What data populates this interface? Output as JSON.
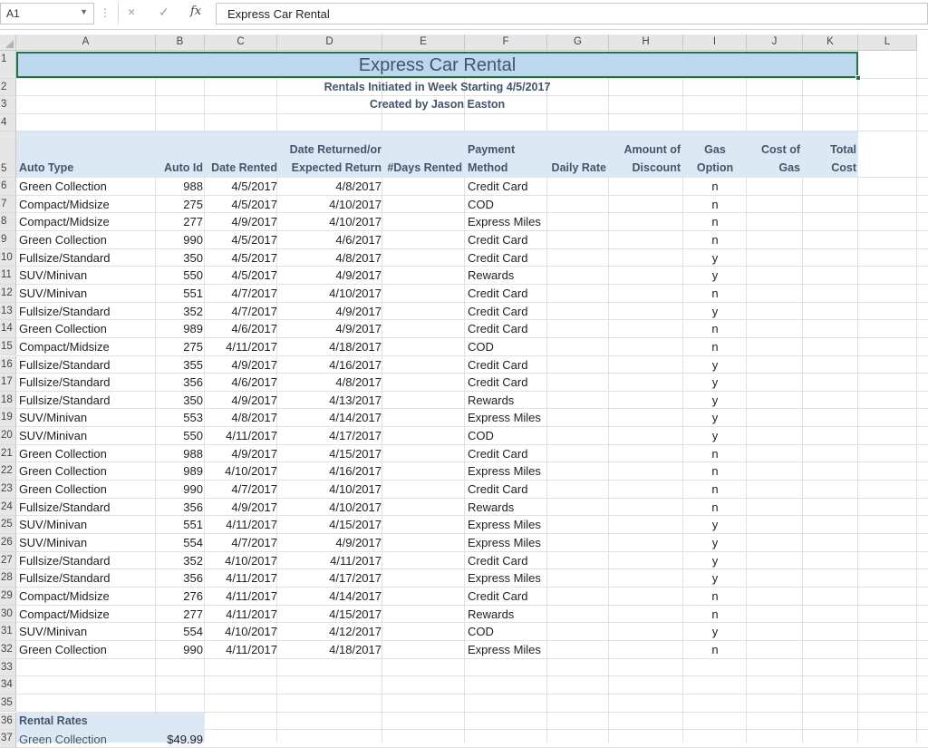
{
  "formula_bar": {
    "name_box": "A1",
    "formula": "Express Car Rental",
    "fx": "fx",
    "cancel": "×",
    "enter": "✓",
    "dots": "⋮",
    "dropdown": "▼"
  },
  "columns": [
    "A",
    "B",
    "C",
    "D",
    "E",
    "F",
    "G",
    "H",
    "I",
    "J",
    "K",
    "L"
  ],
  "title": "Express Car Rental",
  "subtitle1": "Rentals Initiated in Week Starting 4/5/2017",
  "subtitle2": "Created by Jason Easton",
  "headers": {
    "auto_type": "Auto Type",
    "auto_id": "Auto Id",
    "date_rented": "Date Rented",
    "returned_l1": "Date Returned/or",
    "returned_l2": "Expected Return",
    "days": "#Days Rented",
    "payment_l1": "Payment",
    "payment_l2": "Method",
    "daily_rate": "Daily Rate",
    "discount_l1": "Amount of",
    "discount_l2": "Discount",
    "gas_l1": "Gas",
    "gas_l2": "Option",
    "costgas_l1": "Cost of",
    "costgas_l2": "Gas",
    "total_l1": "Total",
    "total_l2": "Cost"
  },
  "rows": [
    {
      "type": "Green Collection",
      "id": "988",
      "rented": "4/5/2017",
      "returned": "4/8/2017",
      "payment": "Credit Card",
      "gas": "n"
    },
    {
      "type": "Compact/Midsize",
      "id": "275",
      "rented": "4/5/2017",
      "returned": "4/10/2017",
      "payment": "COD",
      "gas": "n"
    },
    {
      "type": "Compact/Midsize",
      "id": "277",
      "rented": "4/9/2017",
      "returned": "4/10/2017",
      "payment": "Express Miles",
      "gas": "n"
    },
    {
      "type": "Green Collection",
      "id": "990",
      "rented": "4/5/2017",
      "returned": "4/6/2017",
      "payment": "Credit Card",
      "gas": "n"
    },
    {
      "type": "Fullsize/Standard",
      "id": "350",
      "rented": "4/5/2017",
      "returned": "4/8/2017",
      "payment": "Credit Card",
      "gas": "y"
    },
    {
      "type": "SUV/Minivan",
      "id": "550",
      "rented": "4/5/2017",
      "returned": "4/9/2017",
      "payment": "Rewards",
      "gas": "y"
    },
    {
      "type": "SUV/Minivan",
      "id": "551",
      "rented": "4/7/2017",
      "returned": "4/10/2017",
      "payment": "Credit Card",
      "gas": "n"
    },
    {
      "type": "Fullsize/Standard",
      "id": "352",
      "rented": "4/7/2017",
      "returned": "4/9/2017",
      "payment": "Credit Card",
      "gas": "y"
    },
    {
      "type": "Green Collection",
      "id": "989",
      "rented": "4/6/2017",
      "returned": "4/9/2017",
      "payment": "Credit Card",
      "gas": "n"
    },
    {
      "type": "Compact/Midsize",
      "id": "275",
      "rented": "4/11/2017",
      "returned": "4/18/2017",
      "payment": "COD",
      "gas": "n"
    },
    {
      "type": "Fullsize/Standard",
      "id": "355",
      "rented": "4/9/2017",
      "returned": "4/16/2017",
      "payment": "Credit Card",
      "gas": "y"
    },
    {
      "type": "Fullsize/Standard",
      "id": "356",
      "rented": "4/6/2017",
      "returned": "4/8/2017",
      "payment": "Credit Card",
      "gas": "y"
    },
    {
      "type": "Fullsize/Standard",
      "id": "350",
      "rented": "4/9/2017",
      "returned": "4/13/2017",
      "payment": "Rewards",
      "gas": "y"
    },
    {
      "type": "SUV/Minivan",
      "id": "553",
      "rented": "4/8/2017",
      "returned": "4/14/2017",
      "payment": "Express Miles",
      "gas": "y"
    },
    {
      "type": "SUV/Minivan",
      "id": "550",
      "rented": "4/11/2017",
      "returned": "4/17/2017",
      "payment": "COD",
      "gas": "y"
    },
    {
      "type": "Green Collection",
      "id": "988",
      "rented": "4/9/2017",
      "returned": "4/15/2017",
      "payment": "Credit Card",
      "gas": "n"
    },
    {
      "type": "Green Collection",
      "id": "989",
      "rented": "4/10/2017",
      "returned": "4/16/2017",
      "payment": "Express Miles",
      "gas": "n"
    },
    {
      "type": "Green Collection",
      "id": "990",
      "rented": "4/7/2017",
      "returned": "4/10/2017",
      "payment": "Credit Card",
      "gas": "n"
    },
    {
      "type": "Fullsize/Standard",
      "id": "356",
      "rented": "4/9/2017",
      "returned": "4/10/2017",
      "payment": "Rewards",
      "gas": "n"
    },
    {
      "type": "SUV/Minivan",
      "id": "551",
      "rented": "4/11/2017",
      "returned": "4/15/2017",
      "payment": "Express Miles",
      "gas": "y"
    },
    {
      "type": "SUV/Minivan",
      "id": "554",
      "rented": "4/7/2017",
      "returned": "4/9/2017",
      "payment": "Express Miles",
      "gas": "y"
    },
    {
      "type": "Fullsize/Standard",
      "id": "352",
      "rented": "4/10/2017",
      "returned": "4/11/2017",
      "payment": "Credit Card",
      "gas": "y"
    },
    {
      "type": "Fullsize/Standard",
      "id": "356",
      "rented": "4/11/2017",
      "returned": "4/17/2017",
      "payment": "Express Miles",
      "gas": "y"
    },
    {
      "type": "Compact/Midsize",
      "id": "276",
      "rented": "4/11/2017",
      "returned": "4/14/2017",
      "payment": "Credit Card",
      "gas": "n"
    },
    {
      "type": "Compact/Midsize",
      "id": "277",
      "rented": "4/11/2017",
      "returned": "4/15/2017",
      "payment": "Rewards",
      "gas": "n"
    },
    {
      "type": "SUV/Minivan",
      "id": "554",
      "rented": "4/10/2017",
      "returned": "4/12/2017",
      "payment": "COD",
      "gas": "y"
    },
    {
      "type": "Green Collection",
      "id": "990",
      "rented": "4/11/2017",
      "returned": "4/18/2017",
      "payment": "Express Miles",
      "gas": "n"
    }
  ],
  "rental_rates_label": "Rental Rates",
  "rate_row37_label": "Green Collection",
  "rate_row37_value": "$49.99"
}
